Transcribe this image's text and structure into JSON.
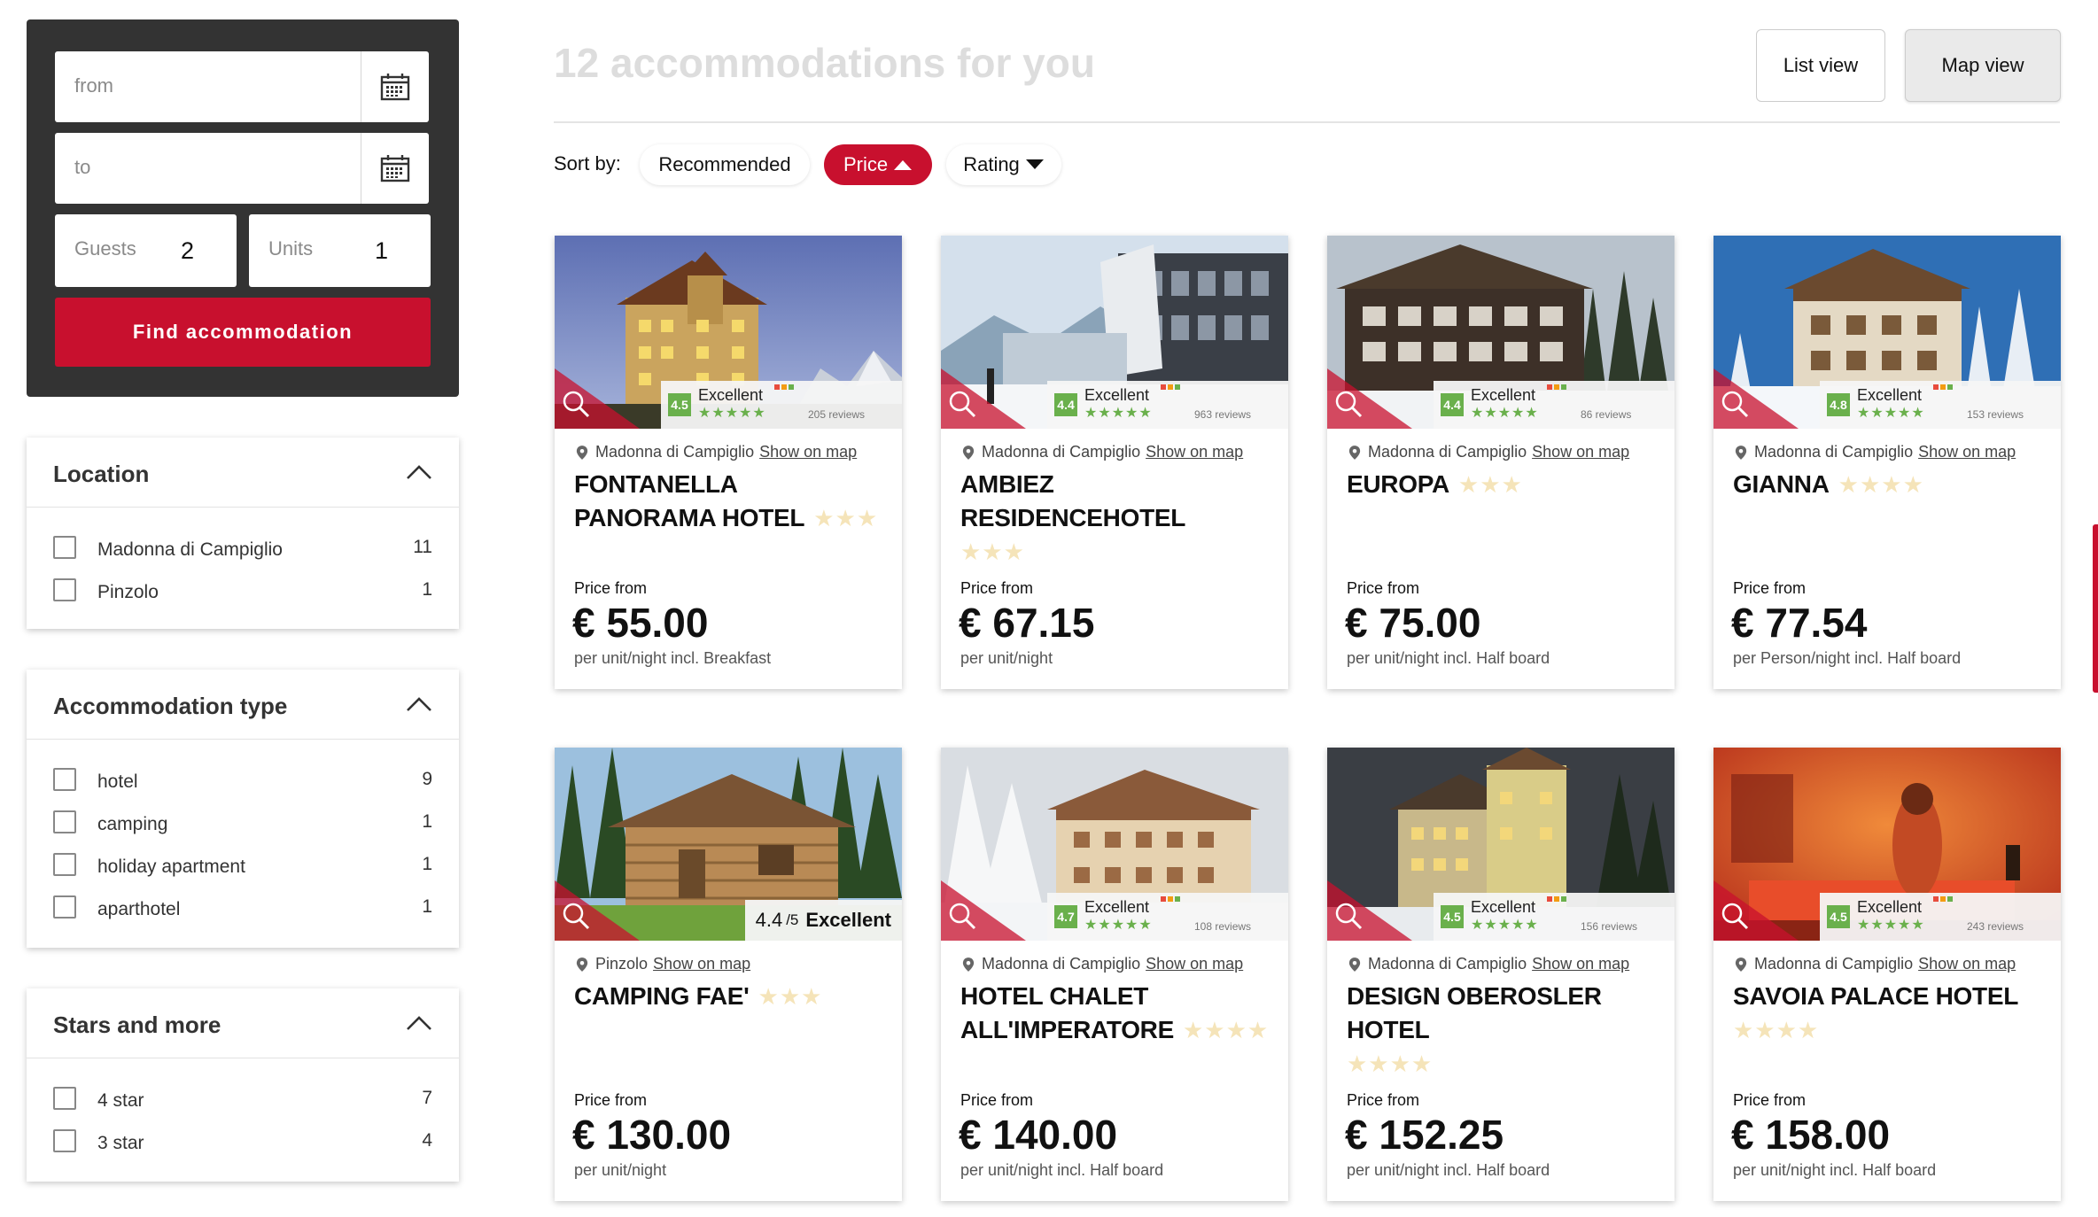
{
  "search": {
    "from_placeholder": "from",
    "to_placeholder": "to",
    "guests_label": "Guests",
    "guests_value": "2",
    "units_label": "Units",
    "units_value": "1",
    "find_label": "Find accommodation"
  },
  "filters": {
    "location": {
      "title": "Location",
      "options": [
        {
          "label": "Madonna di Campiglio",
          "count": "11"
        },
        {
          "label": "Pinzolo",
          "count": "1"
        }
      ]
    },
    "accommodation_type": {
      "title": "Accommodation type",
      "options": [
        {
          "label": "hotel",
          "count": "9"
        },
        {
          "label": "camping",
          "count": "1"
        },
        {
          "label": "holiday apartment",
          "count": "1"
        },
        {
          "label": "aparthotel",
          "count": "1"
        }
      ]
    },
    "stars": {
      "title": "Stars and more",
      "options": [
        {
          "label": "4 star",
          "count": "7"
        },
        {
          "label": "3 star",
          "count": "4"
        }
      ]
    }
  },
  "header": {
    "title": "12 accommodations for you",
    "list_view": "List view",
    "map_view": "Map view"
  },
  "sort": {
    "label": "Sort by:",
    "recommended": "Recommended",
    "price": "Price",
    "rating": "Rating"
  },
  "cards": [
    {
      "location": "Madonna di Campiglio",
      "map_link": "Show on map",
      "name": "FONTANELLA PANORAMA HOTEL",
      "stars": "★★★",
      "score": "4.5",
      "rating_label": "Excellent",
      "rating_stars": "★★★★★",
      "reviews": "205 reviews",
      "price_from": "Price from",
      "price": "€ 55.00",
      "price_note": "per unit/night incl. Breakfast"
    },
    {
      "location": "Madonna di Campiglio",
      "map_link": "Show on map",
      "name": "AMBIEZ RESIDENCEHOTEL",
      "stars": "★★★",
      "score": "4.4",
      "rating_label": "Excellent",
      "rating_stars": "★★★★★",
      "reviews": "963 reviews",
      "price_from": "Price from",
      "price": "€ 67.15",
      "price_note": "per unit/night"
    },
    {
      "location": "Madonna di Campiglio",
      "map_link": "Show on map",
      "name": "EUROPA",
      "stars": "★★★",
      "score": "4.4",
      "rating_label": "Excellent",
      "rating_stars": "★★★★★",
      "reviews": "86 reviews",
      "price_from": "Price from",
      "price": "€ 75.00",
      "price_note": "per unit/night incl. Half board"
    },
    {
      "location": "Madonna di Campiglio",
      "map_link": "Show on map",
      "name": "GIANNA",
      "stars": "★★★★",
      "score": "4.8",
      "rating_label": "Excellent",
      "rating_stars": "★★★★★",
      "reviews": "153 reviews",
      "price_from": "Price from",
      "price": "€ 77.54",
      "price_note": "per Person/night incl. Half board"
    },
    {
      "location": "Pinzolo",
      "map_link": "Show on map",
      "name": "CAMPING FAE'",
      "stars": "★★★",
      "score": "4.4",
      "score_suffix": "/5",
      "rating_label": "Excellent",
      "price_from": "Price from",
      "price": "€ 130.00",
      "price_note": "per unit/night"
    },
    {
      "location": "Madonna di Campiglio",
      "map_link": "Show on map",
      "name": "HOTEL CHALET ALL'IMPERATORE",
      "stars": "★★★★",
      "score": "4.7",
      "rating_label": "Excellent",
      "rating_stars": "★★★★★",
      "reviews": "108 reviews",
      "price_from": "Price from",
      "price": "€ 140.00",
      "price_note": "per unit/night incl. Half board"
    },
    {
      "location": "Madonna di Campiglio",
      "map_link": "Show on map",
      "name": "DESIGN OBEROSLER HOTEL",
      "stars": "★★★★",
      "score": "4.5",
      "rating_label": "Excellent",
      "rating_stars": "★★★★★",
      "reviews": "156 reviews",
      "price_from": "Price from",
      "price": "€ 152.25",
      "price_note": "per unit/night incl. Half board"
    },
    {
      "location": "Madonna di Campiglio",
      "map_link": "Show on map",
      "name": "SAVOIA PALACE HOTEL",
      "stars": "★★★★",
      "score": "4.5",
      "rating_label": "Excellent",
      "rating_stars": "★★★★★",
      "reviews": "243 reviews",
      "price_from": "Price from",
      "price": "€ 158.00",
      "price_note": "per unit/night incl. Half board"
    }
  ],
  "colors": {
    "accent": "#c8102e",
    "score_green": "#6ab04c",
    "panel_dark": "#333333"
  }
}
